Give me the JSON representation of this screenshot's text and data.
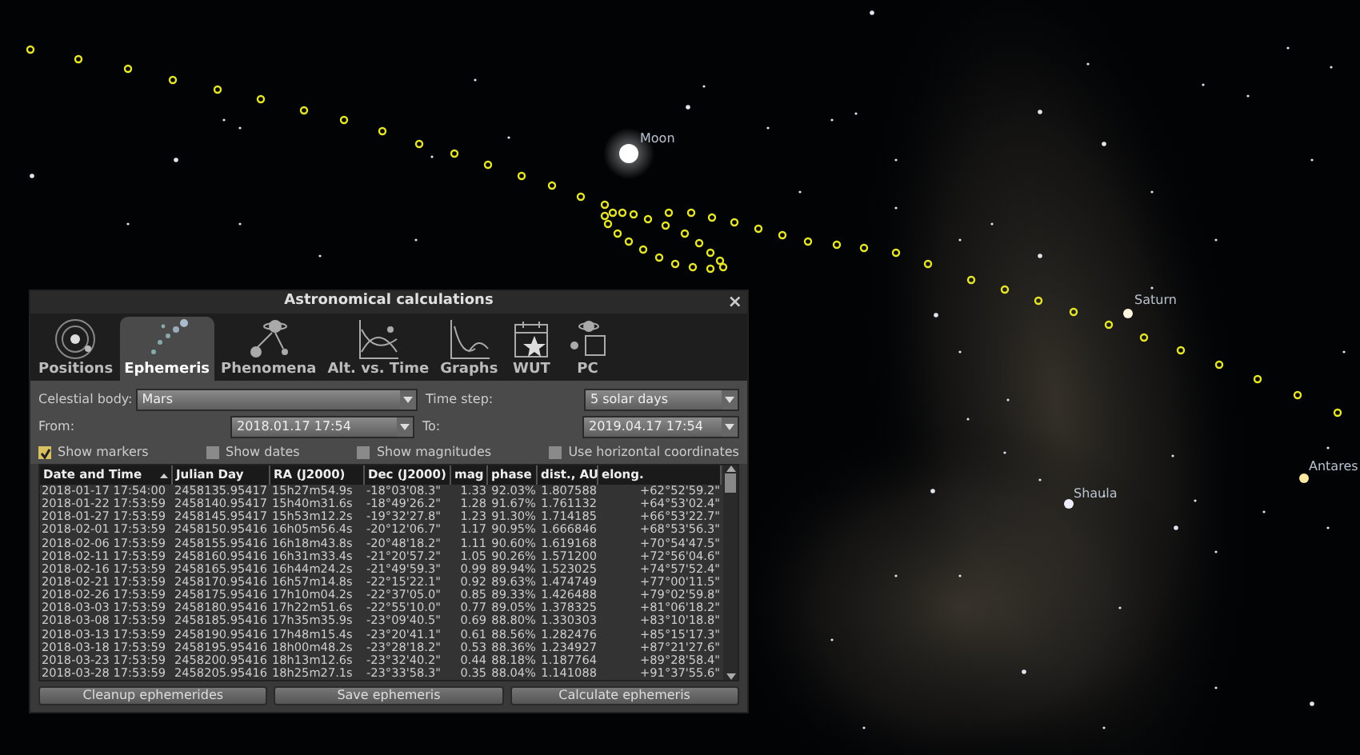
{
  "sky": {
    "labels": [
      {
        "kind": "moon",
        "text": "Moon"
      },
      {
        "kind": "saturn",
        "text": "Saturn"
      },
      {
        "kind": "shaula",
        "text": "Shaula"
      },
      {
        "kind": "antares",
        "text": "Antares"
      }
    ]
  },
  "dialog": {
    "title": "Astronomical calculations",
    "close": "×",
    "tabs": [
      {
        "label": "Positions",
        "selected": false
      },
      {
        "label": "Ephemeris",
        "selected": true
      },
      {
        "label": "Phenomena",
        "selected": false
      },
      {
        "label": "Alt. vs. Time",
        "selected": false
      },
      {
        "label": "Graphs",
        "selected": false
      },
      {
        "label": "WUT",
        "selected": false
      },
      {
        "label": "PC",
        "selected": false
      }
    ],
    "celestial_body": {
      "label": "Celestial body:",
      "value": "Mars"
    },
    "time_step": {
      "label": "Time step:",
      "value": "5 solar days"
    },
    "from": {
      "label": "From:",
      "value": "2018.01.17 17:54"
    },
    "to": {
      "label": "To:",
      "value": "2019.04.17 17:54"
    },
    "options": [
      {
        "label": "Show markers",
        "checked": true
      },
      {
        "label": "Show dates",
        "checked": false
      },
      {
        "label": "Show magnitudes",
        "checked": false
      },
      {
        "label": "Use horizontal coordinates",
        "checked": false
      }
    ],
    "table": {
      "columns": [
        "Date and Time",
        "Julian Day",
        "RA (J2000)",
        "Dec (J2000)",
        "mag",
        "phase",
        "dist., AU",
        "elong."
      ],
      "rows": [
        [
          "2018-01-17 17:54:00",
          "2458135.95417",
          "15h27m54.9s",
          "-18°03'08.3\"",
          "1.33",
          "92.03%",
          "1.807588",
          "+62°52'59.2\""
        ],
        [
          "2018-01-22 17:53:59",
          "2458140.95417",
          "15h40m31.6s",
          "-18°49'26.2\"",
          "1.28",
          "91.67%",
          "1.761132",
          "+64°53'02.4\""
        ],
        [
          "2018-01-27 17:53:59",
          "2458145.95417",
          "15h53m12.2s",
          "-19°32'27.8\"",
          "1.23",
          "91.30%",
          "1.714185",
          "+66°53'22.7\""
        ],
        [
          "2018-02-01 17:53:59",
          "2458150.95416",
          "16h05m56.4s",
          "-20°12'06.7\"",
          "1.17",
          "90.95%",
          "1.666846",
          "+68°53'56.3\""
        ],
        [
          "2018-02-06 17:53:59",
          "2458155.95416",
          "16h18m43.8s",
          "-20°48'18.2\"",
          "1.11",
          "90.60%",
          "1.619168",
          "+70°54'47.5\""
        ],
        [
          "2018-02-11 17:53:59",
          "2458160.95416",
          "16h31m33.4s",
          "-21°20'57.2\"",
          "1.05",
          "90.26%",
          "1.571200",
          "+72°56'04.6\""
        ],
        [
          "2018-02-16 17:53:59",
          "2458165.95416",
          "16h44m24.2s",
          "-21°49'59.3\"",
          "0.99",
          "89.94%",
          "1.523025",
          "+74°57'52.4\""
        ],
        [
          "2018-02-21 17:53:59",
          "2458170.95416",
          "16h57m14.8s",
          "-22°15'22.1\"",
          "0.92",
          "89.63%",
          "1.474749",
          "+77°00'11.5\""
        ],
        [
          "2018-02-26 17:53:59",
          "2458175.95416",
          "17h10m04.2s",
          "-22°37'05.0\"",
          "0.85",
          "89.33%",
          "1.426488",
          "+79°02'59.8\""
        ],
        [
          "2018-03-03 17:53:59",
          "2458180.95416",
          "17h22m51.6s",
          "-22°55'10.0\"",
          "0.77",
          "89.05%",
          "1.378325",
          "+81°06'18.2\""
        ],
        [
          "2018-03-08 17:53:59",
          "2458185.95416",
          "17h35m35.9s",
          "-23°09'40.5\"",
          "0.69",
          "88.80%",
          "1.330303",
          "+83°10'18.8\""
        ],
        [
          "2018-03-13 17:53:59",
          "2458190.95416",
          "17h48m15.4s",
          "-23°20'41.1\"",
          "0.61",
          "88.56%",
          "1.282476",
          "+85°15'17.3\""
        ],
        [
          "2018-03-18 17:53:59",
          "2458195.95416",
          "18h00m48.2s",
          "-23°28'18.2\"",
          "0.53",
          "88.36%",
          "1.234927",
          "+87°21'27.6\""
        ],
        [
          "2018-03-23 17:53:59",
          "2458200.95416",
          "18h13m12.6s",
          "-23°32'40.2\"",
          "0.44",
          "88.18%",
          "1.187764",
          "+89°28'58.4\""
        ],
        [
          "2018-03-28 17:53:59",
          "2458205.95416",
          "18h25m27.1s",
          "-23°33'58.3\"",
          "0.35",
          "88.04%",
          "1.141088",
          "+91°37'55.6\""
        ]
      ]
    },
    "buttons": [
      "Cleanup ephemerides",
      "Save ephemeris",
      "Calculate ephemeris"
    ]
  }
}
